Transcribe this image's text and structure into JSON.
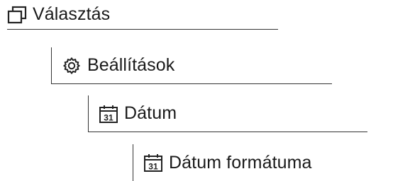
{
  "breadcrumb": {
    "items": [
      {
        "label": "Választás",
        "icon": "windows-icon"
      },
      {
        "label": "Beállítások",
        "icon": "gear-icon"
      },
      {
        "label": "Dátum",
        "icon": "calendar-icon"
      },
      {
        "label": "Dátum formátuma",
        "icon": "calendar-icon"
      }
    ],
    "calendar_day": "31"
  }
}
